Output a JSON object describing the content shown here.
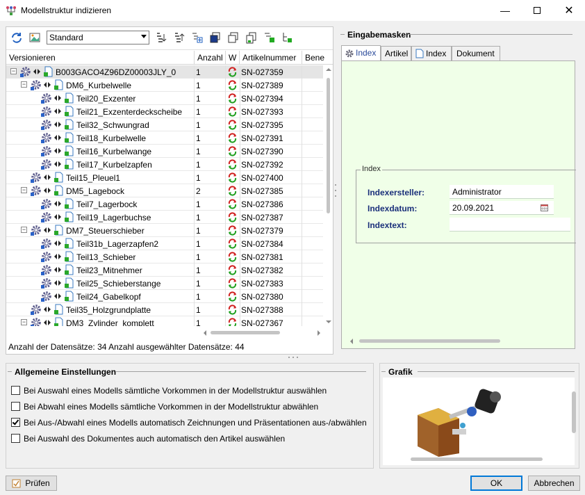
{
  "window": {
    "title": "Modellstruktur indizieren"
  },
  "toolbar": {
    "view_combo_value": "Standard"
  },
  "grid": {
    "columns": [
      "Versionieren",
      "Anzahl",
      "W",
      "Artikelnummer",
      "Bene"
    ],
    "rows": [
      {
        "name": "B003GACO4Z96DZ00003JLY_0",
        "anzahl": "1",
        "artikel": "SN-027359",
        "level": 0,
        "expander": "⊟",
        "selected": true
      },
      {
        "name": "DM6_Kurbelwelle",
        "anzahl": "1",
        "artikel": "SN-027389",
        "level": 1,
        "expander": "⊟"
      },
      {
        "name": "Teil20_Exzenter",
        "anzahl": "1",
        "artikel": "SN-027394",
        "level": 2
      },
      {
        "name": "Teil21_Exzenterdeckscheibe",
        "anzahl": "1",
        "artikel": "SN-027393",
        "level": 2
      },
      {
        "name": "Teil32_Schwungrad",
        "anzahl": "1",
        "artikel": "SN-027395",
        "level": 2
      },
      {
        "name": "Teil18_Kurbelwelle",
        "anzahl": "1",
        "artikel": "SN-027391",
        "level": 2
      },
      {
        "name": "Teil16_Kurbelwange",
        "anzahl": "1",
        "artikel": "SN-027390",
        "level": 2
      },
      {
        "name": "Teil17_Kurbelzapfen",
        "anzahl": "1",
        "artikel": "SN-027392",
        "level": 2
      },
      {
        "name": "Teil15_Pleuel1",
        "anzahl": "1",
        "artikel": "SN-027400",
        "level": 1
      },
      {
        "name": "DM5_Lagebock",
        "anzahl": "2",
        "artikel": "SN-027385",
        "level": 1,
        "expander": "⊟"
      },
      {
        "name": "Teil7_Lagerbock",
        "anzahl": "1",
        "artikel": "SN-027386",
        "level": 2
      },
      {
        "name": "Teil19_Lagerbuchse",
        "anzahl": "1",
        "artikel": "SN-027387",
        "level": 2
      },
      {
        "name": "DM7_Steuerschieber",
        "anzahl": "1",
        "artikel": "SN-027379",
        "level": 1,
        "expander": "⊟"
      },
      {
        "name": "Teil31b_Lagerzapfen2",
        "anzahl": "1",
        "artikel": "SN-027384",
        "level": 2
      },
      {
        "name": "Teil13_Schieber",
        "anzahl": "1",
        "artikel": "SN-027381",
        "level": 2
      },
      {
        "name": "Teil23_Mitnehmer",
        "anzahl": "1",
        "artikel": "SN-027382",
        "level": 2
      },
      {
        "name": "Teil25_Schieberstange",
        "anzahl": "1",
        "artikel": "SN-027383",
        "level": 2
      },
      {
        "name": "Teil24_Gabelkopf",
        "anzahl": "1",
        "artikel": "SN-027380",
        "level": 2
      },
      {
        "name": "Teil35_Holzgrundplatte",
        "anzahl": "1",
        "artikel": "SN-027388",
        "level": 1
      },
      {
        "name": "DM3_Zylinder_komplett",
        "anzahl": "1",
        "artikel": "SN-027367",
        "level": 1,
        "expander": "⊟"
      }
    ],
    "status": "Anzahl der Datensätze: 34   Anzahl ausgewählter Datensätze: 44"
  },
  "eingabemasken": {
    "title": "Eingabemasken",
    "tabs": [
      "Index",
      "Artikel",
      "Index",
      "Dokument"
    ],
    "group_title": "Index",
    "fields": [
      {
        "label": "Indexersteller:",
        "value": "Administrator"
      },
      {
        "label": "Indexdatum:",
        "value": "20.09.2021"
      },
      {
        "label": "Indextext:",
        "value": ""
      }
    ]
  },
  "settings": {
    "title": "Allgemeine Einstellungen",
    "options": [
      {
        "label": "Bei Auswahl eines Modells sämtliche Vorkommen in der Modellstruktur auswählen",
        "checked": false
      },
      {
        "label": "Bei Abwahl eines Modells sämtliche Vorkommen in der Modellstruktur abwählen",
        "checked": false
      },
      {
        "label": "Bei Aus-/Abwahl eines Modells automatisch Zeichnungen und Präsentationen aus-/abwählen",
        "checked": true
      },
      {
        "label": "Bei Auswahl des Dokumentes auch automatisch den Artikel auswählen",
        "checked": false
      }
    ]
  },
  "grafik": {
    "title": "Grafik"
  },
  "buttons": {
    "pruefen": "Prüfen",
    "ok": "OK",
    "abbrechen": "Abbrechen"
  },
  "colors": {
    "accent": "#0078d7",
    "tab_bg": "#f0ffe8",
    "label_blue": "#1a2f7a"
  }
}
